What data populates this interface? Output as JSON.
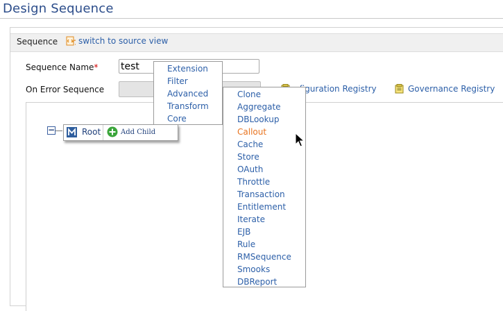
{
  "page": {
    "title": "Design Sequence"
  },
  "sequence_panel": {
    "header": "Sequence",
    "switch_link": "switch to source view"
  },
  "form": {
    "name_label": "Sequence Name",
    "required_mark": "*",
    "name_value": "test",
    "on_error_label": "On Error Sequence",
    "configuration_registry_link": "nfiguration Registry",
    "governance_registry_link": "Governance Registry"
  },
  "tree": {
    "collapse_symbol": "−",
    "root_label": "Root",
    "add_child_label": "Add Child"
  },
  "category_menu": {
    "items": [
      "Extension",
      "Filter",
      "Advanced",
      "Transform",
      "Core"
    ]
  },
  "advanced_submenu": {
    "items": [
      "Clone",
      "Aggregate",
      "DBLookup",
      "Callout",
      "Cache",
      "Store",
      "OAuth",
      "Throttle",
      "Transaction",
      "Entitlement",
      "Iterate",
      "EJB",
      "Rule",
      "RMSequence",
      "Smooks",
      "DBReport"
    ],
    "highlighted": "Callout"
  },
  "colors": {
    "link": "#2c5fa8",
    "highlight": "#e8731f",
    "required": "#d10000",
    "title": "#2b4c8a"
  },
  "icons": {
    "switch": "source-view-icon",
    "registry": "registry-icon",
    "root_node": "mediator-m-icon",
    "add": "plus-circle-icon"
  }
}
